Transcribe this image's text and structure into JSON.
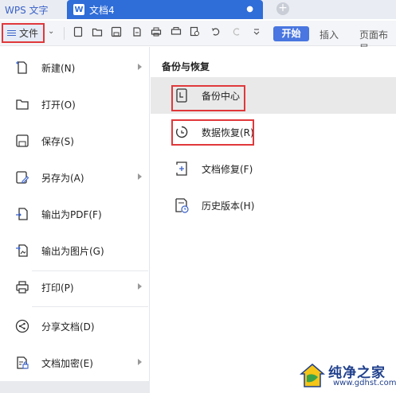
{
  "tabbar": {
    "app_tab": "WPS 文字",
    "doc_tab": "文档4",
    "doc_icon_letter": "W",
    "doc_dot": "●",
    "add_tab": "+"
  },
  "toolbar": {
    "file_label": "文件",
    "start_label": "开始",
    "insert_label": "插入",
    "layout_label": "页面布局"
  },
  "left_menu": {
    "items": [
      {
        "label": "新建(N)",
        "icon": "new-doc-icon",
        "has_submenu": true
      },
      {
        "label": "打开(O)",
        "icon": "folder-icon",
        "has_submenu": false
      },
      {
        "label": "保存(S)",
        "icon": "save-icon",
        "has_submenu": false
      },
      {
        "label": "另存为(A)",
        "icon": "save-as-icon",
        "has_submenu": true
      },
      {
        "label": "输出为PDF(F)",
        "icon": "export-pdf-icon",
        "has_submenu": false
      },
      {
        "label": "输出为图片(G)",
        "icon": "export-image-icon",
        "has_submenu": false
      },
      {
        "label": "打印(P)",
        "icon": "print-icon",
        "has_submenu": true
      },
      {
        "label": "分享文档(D)",
        "icon": "share-icon",
        "has_submenu": false
      },
      {
        "label": "文档加密(E)",
        "icon": "lock-doc-icon",
        "has_submenu": true
      }
    ]
  },
  "right_panel": {
    "heading": "备份与恢复",
    "items": [
      {
        "label": "备份中心",
        "icon": "backup-center-icon",
        "selected": true
      },
      {
        "label": "数据恢复(R)",
        "icon": "data-recovery-icon",
        "selected": false
      },
      {
        "label": "文档修复(F)",
        "icon": "doc-repair-icon",
        "selected": false
      },
      {
        "label": "历史版本(H)",
        "icon": "history-version-icon",
        "selected": false
      }
    ]
  },
  "watermark": {
    "title": "纯净之家",
    "url": "www.gdhst.com"
  },
  "colors": {
    "accent": "#2f6dd8",
    "start_button": "#4976e0",
    "highlight_box": "#e0383b"
  }
}
